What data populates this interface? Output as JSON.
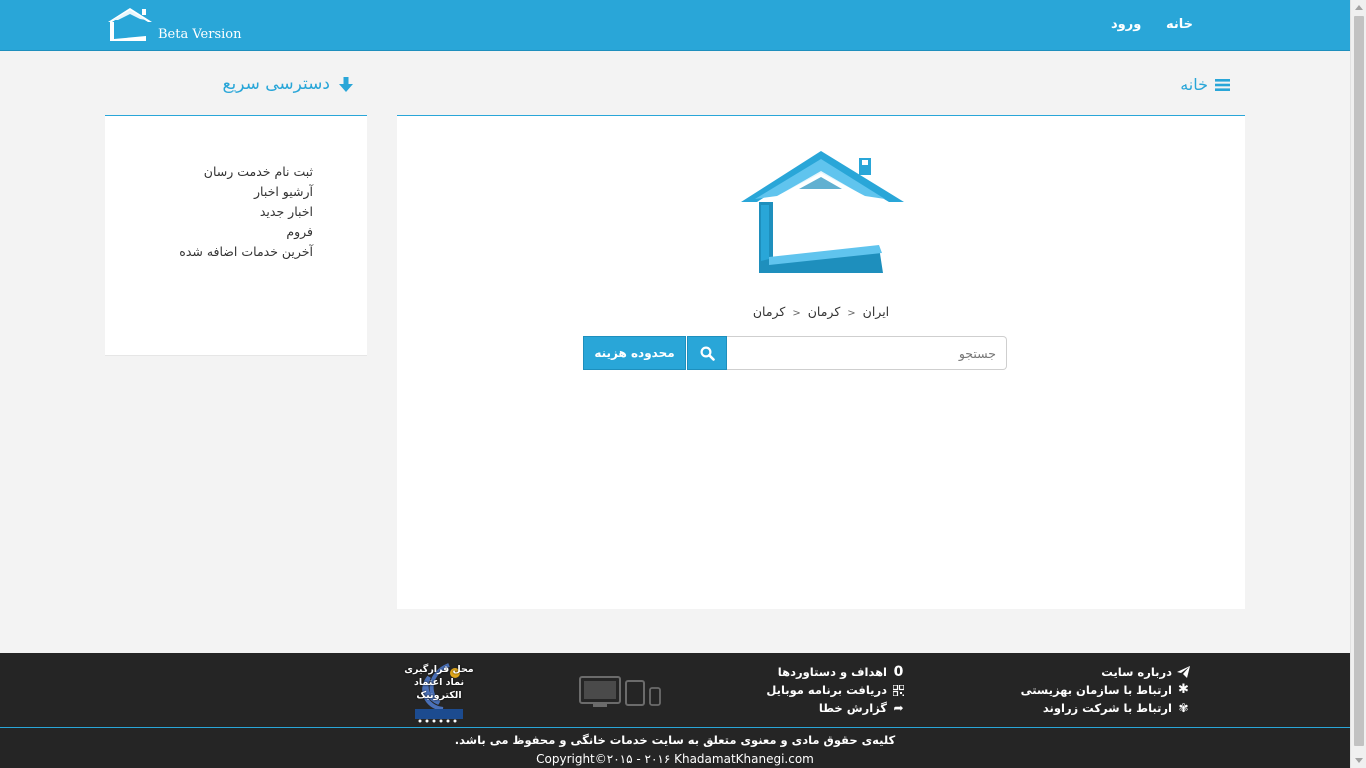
{
  "brand": {
    "version": "Beta Version"
  },
  "navbar": {
    "home": "خانه",
    "login": "ورود"
  },
  "quick_access": {
    "title": "دسترسی سریع",
    "items": [
      "ثبت نام خدمت رسان",
      "آرشیو اخبار",
      "اخبار جدید",
      "فروم",
      "آخرین خدمات اضافه شده"
    ]
  },
  "main": {
    "title": "خانه",
    "breadcrumb": [
      "ایران",
      "کرمان",
      "کرمان"
    ],
    "search_placeholder": "جستجو",
    "range_button": "محدوده هزینه"
  },
  "footer": {
    "col1": [
      {
        "label": "درباره سایت",
        "icon": "paper-plane-icon"
      },
      {
        "label": "ارتباط با سازمان بهزیستی",
        "icon": "asterisk-icon"
      },
      {
        "label": "ارتباط با شرکت زراوند",
        "icon": "yelp-icon"
      }
    ],
    "col2": [
      {
        "label": "اهداف و دستاوردها",
        "icon": "zero-icon",
        "glyph": "0"
      },
      {
        "label": "دریافت برنامه موبایل",
        "icon": "qrcode-icon"
      },
      {
        "label": "گزارش خطا",
        "icon": "share-icon"
      }
    ],
    "enamad": "محل قرارگیری نماد اعتماد الکترونیک",
    "rights": "کلیه‌ی حقوق مادی و معنوی متعلق به سایت خدمات خانگی و محفوظ می باشد.",
    "copyright": "Copyright©۲۰۱۵ - ۲۰۱۶ KhadamatKhanegi.com"
  },
  "colors": {
    "accent": "#29a6d8",
    "footer_bg": "#252525",
    "page_bg": "#f3f3f3"
  }
}
